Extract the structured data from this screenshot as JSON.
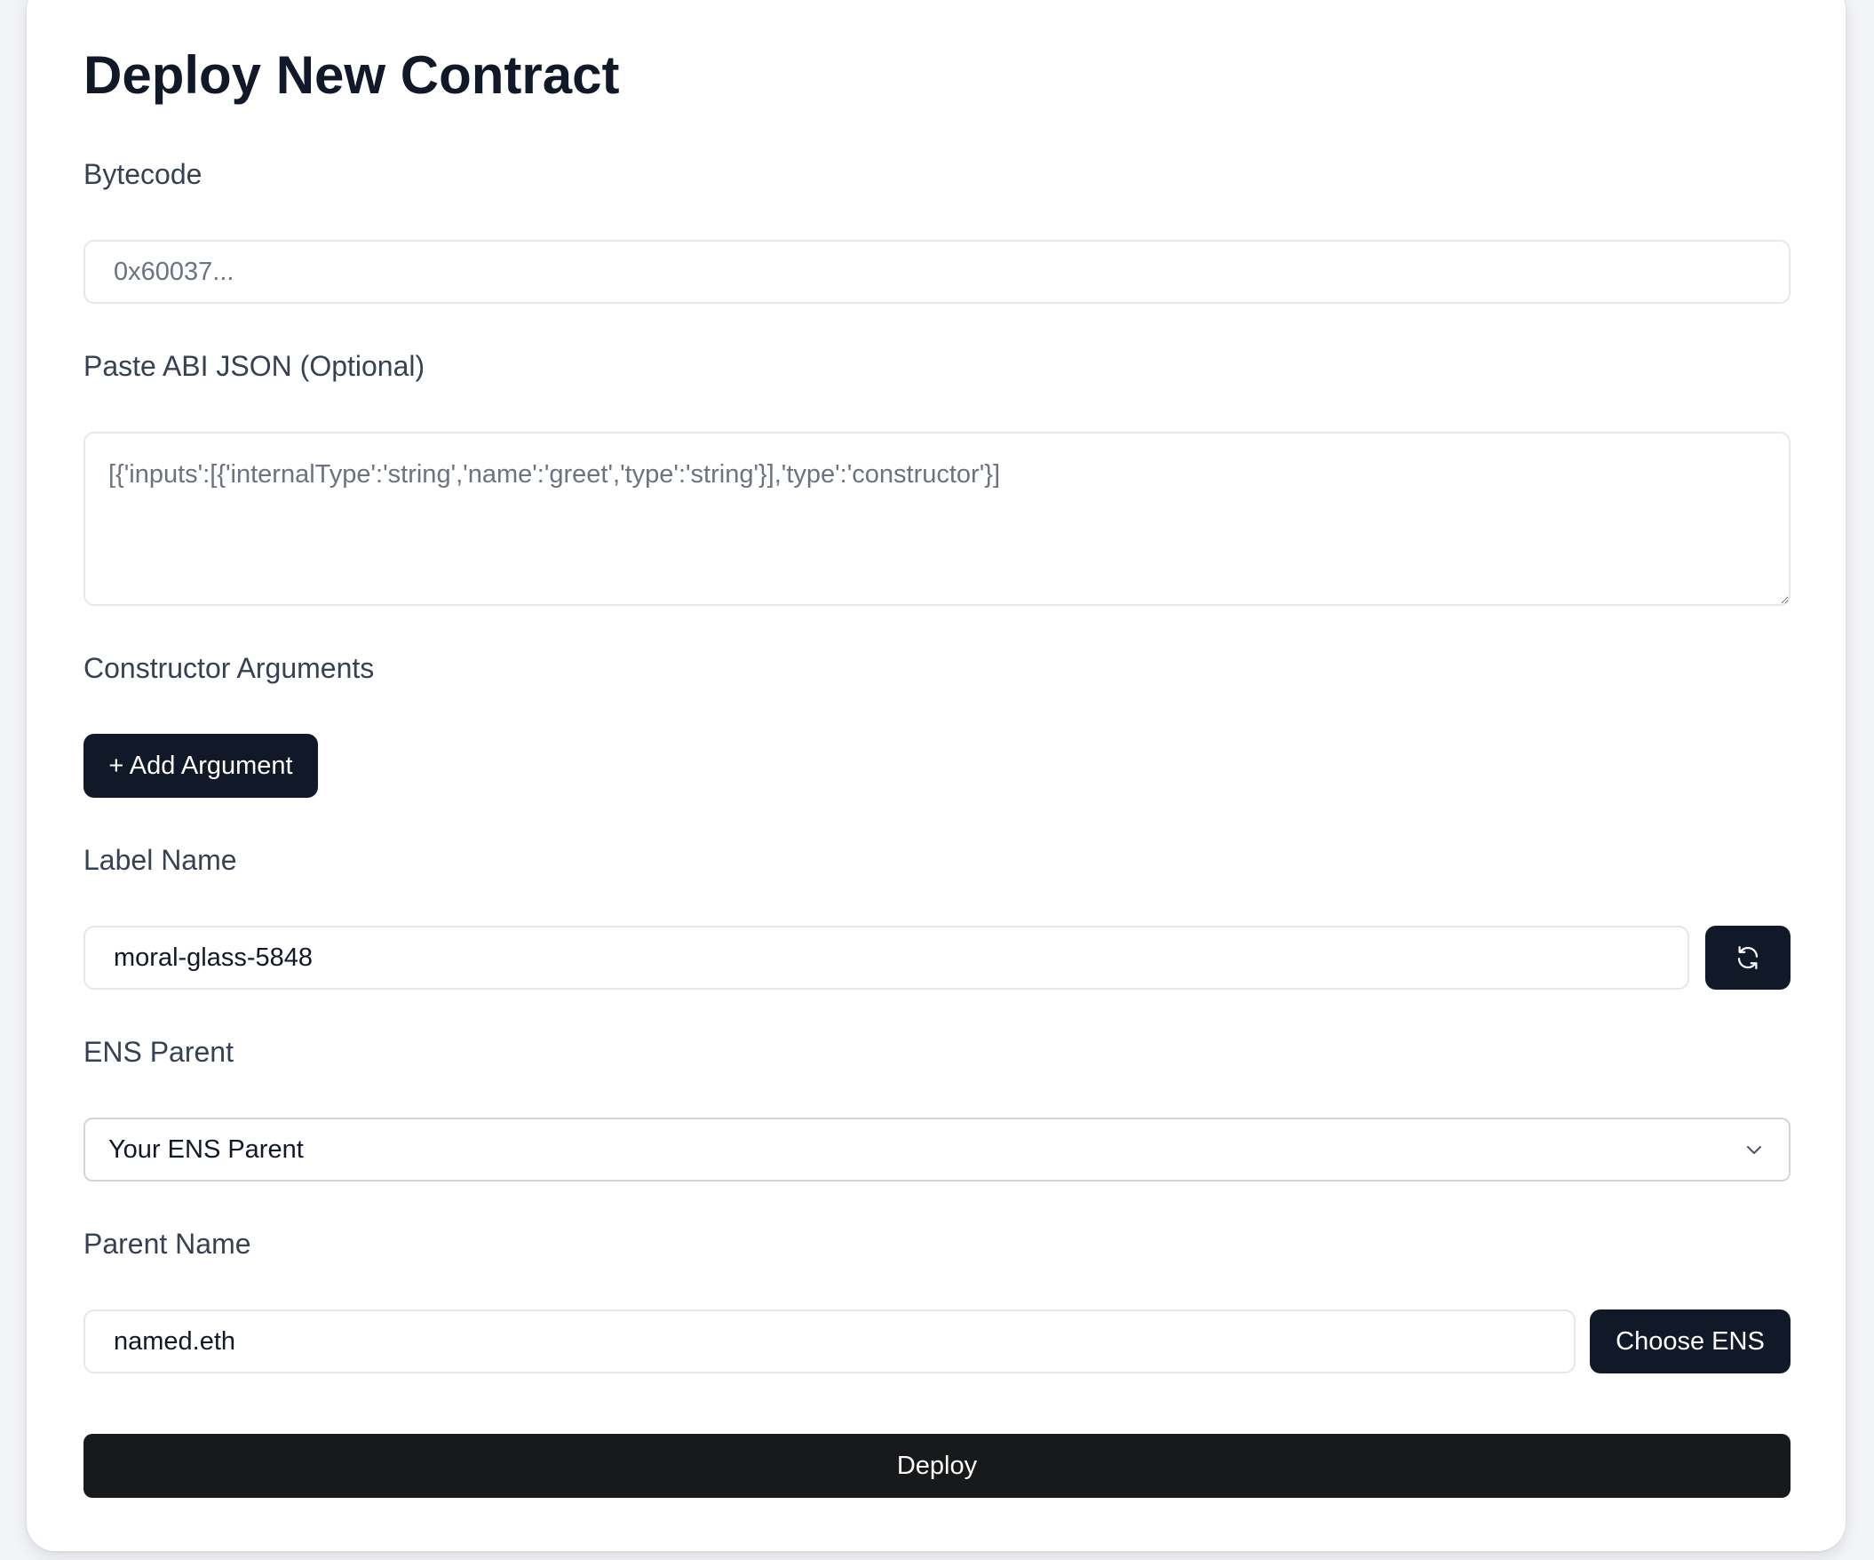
{
  "page": {
    "title": "Deploy New Contract"
  },
  "bytecode": {
    "label": "Bytecode",
    "placeholder": "0x60037...",
    "value": ""
  },
  "abi": {
    "label": "Paste ABI JSON (Optional)",
    "placeholder": "[{'inputs':[{'internalType':'string','name':'greet','type':'string'}],'type':'constructor'}]",
    "value": ""
  },
  "constructor_args": {
    "label": "Constructor Arguments",
    "add_button_label": "+ Add Argument"
  },
  "label_name": {
    "label": "Label Name",
    "value": "moral-glass-5848",
    "regenerate_icon": "refresh-icon"
  },
  "ens_parent": {
    "label": "ENS Parent",
    "selected": "Your ENS Parent",
    "icon": "chevron-down-icon"
  },
  "parent_name": {
    "label": "Parent Name",
    "value": "named.eth",
    "choose_button_label": "Choose ENS"
  },
  "deploy": {
    "label": "Deploy"
  },
  "colors": {
    "primary_button": "#111827",
    "deploy_button": "#18191a",
    "title_text": "#111827",
    "label_text": "#374151",
    "border": "#e5e7eb",
    "background": "#f3f4f6"
  }
}
